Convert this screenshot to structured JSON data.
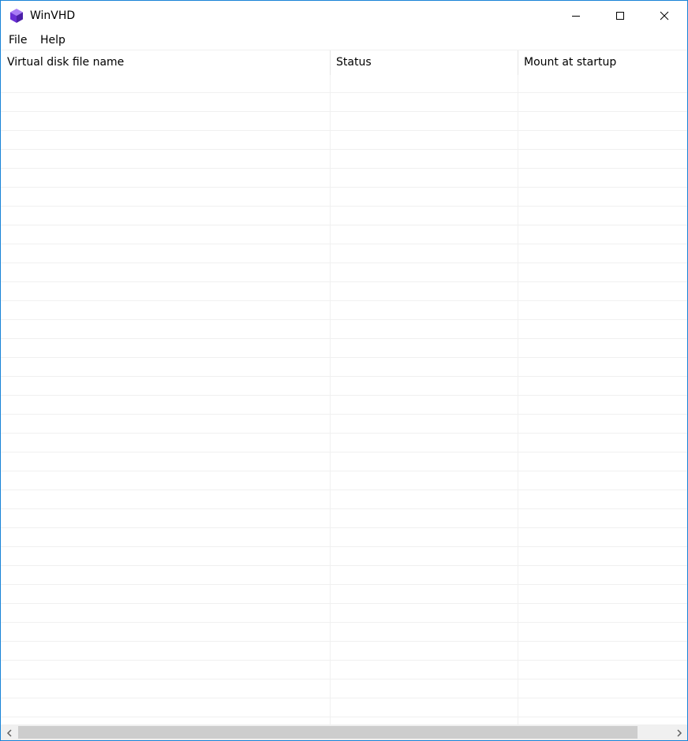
{
  "window": {
    "title": "WinVHD",
    "app_icon": "purple-cube-icon",
    "controls": {
      "minimize_icon": "minimize-icon",
      "maximize_icon": "maximize-icon",
      "close_icon": "close-icon"
    }
  },
  "menu": {
    "items": [
      {
        "label": "File"
      },
      {
        "label": "Help"
      }
    ]
  },
  "listview": {
    "columns": [
      {
        "label": "Virtual disk file name"
      },
      {
        "label": "Status"
      },
      {
        "label": "Mount at startup"
      }
    ],
    "rows": []
  },
  "scrollbar": {
    "left_icon": "chevron-left-icon",
    "right_icon": "chevron-right-icon"
  },
  "colors": {
    "accent": "#1883d7",
    "icon_purple": "#7b3fe4",
    "scroll_track": "#f0f0f0",
    "scroll_thumb": "#cdcdcd",
    "grid_line": "#f0f0f0"
  }
}
